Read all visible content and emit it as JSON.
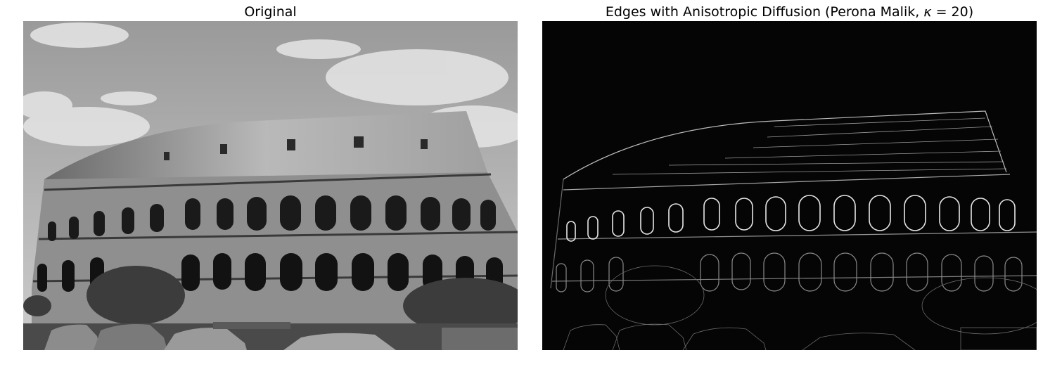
{
  "figure": {
    "left_title": "Original",
    "right_title_prefix": "Edges with Anisotropic Diffusion (Perona Malik, ",
    "right_title_kappa": "κ",
    "right_title_suffix": " = 20)"
  },
  "colors": {
    "sky_top": "#9c9c9c",
    "sky_bottom": "#c9c9c9",
    "stone_light": "#c4c4c4",
    "stone_mid": "#8a8a8a",
    "stone_dark": "#3a3a3a",
    "arch_dark": "#151515",
    "edge_background": "#050505",
    "edge_line": "#cfcfcf"
  }
}
